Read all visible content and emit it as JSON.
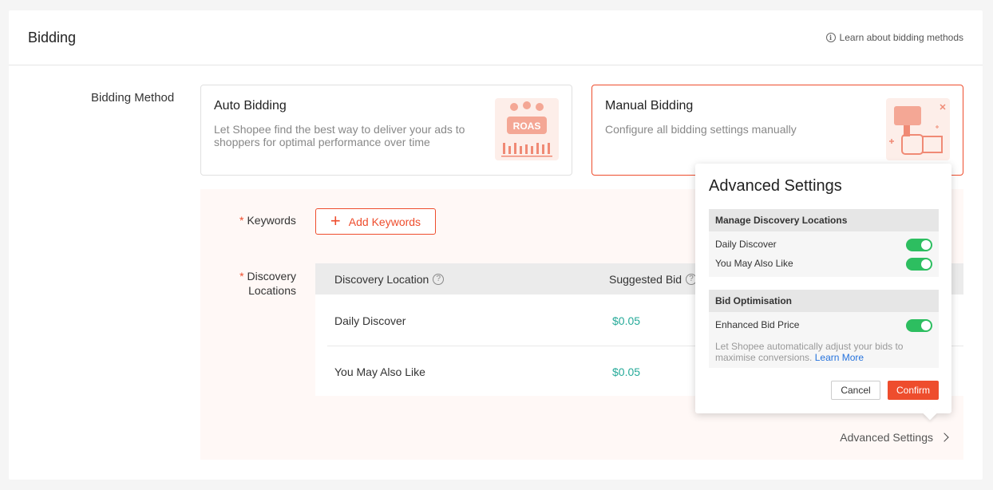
{
  "header": {
    "title": "Bidding",
    "learn_link": "Learn about bidding methods"
  },
  "bidding_method": {
    "label": "Bidding Method",
    "auto": {
      "title": "Auto Bidding",
      "description": "Let Shopee find the best way to deliver your ads to shoppers for optimal performance over time",
      "badge_text": "ROAS"
    },
    "manual": {
      "title": "Manual Bidding",
      "description": "Configure all bidding settings manually"
    }
  },
  "keywords": {
    "label": "Keywords",
    "add_button": "Add Keywords"
  },
  "discovery": {
    "label_line1": "Discovery",
    "label_line2": "Locations",
    "columns": {
      "location": "Discovery Location",
      "suggested_bid": "Suggested Bid"
    },
    "rows": [
      {
        "location": "Daily Discover",
        "bid": "$0.05"
      },
      {
        "location": "You May Also Like",
        "bid": "$0.05"
      }
    ]
  },
  "advanced_link": "Advanced Settings",
  "popover": {
    "title": "Advanced Settings",
    "manage_section": {
      "heading": "Manage Discovery Locations",
      "items": [
        "Daily Discover",
        "You May Also Like"
      ]
    },
    "bid_section": {
      "heading": "Bid Optimisation",
      "item": "Enhanced Bid Price",
      "hint": "Let Shopee automatically adjust your bids to maximise conversions.",
      "learn_more": "Learn More"
    },
    "cancel": "Cancel",
    "confirm": "Confirm"
  },
  "colors": {
    "accent": "#ee4d2d",
    "price": "#26aa99",
    "toggle_on": "#2dbe60",
    "link": "#2673dd"
  },
  "icons": [
    "info-icon",
    "plus-icon",
    "question-icon",
    "chevron-right-icon",
    "toggle-switch"
  ]
}
